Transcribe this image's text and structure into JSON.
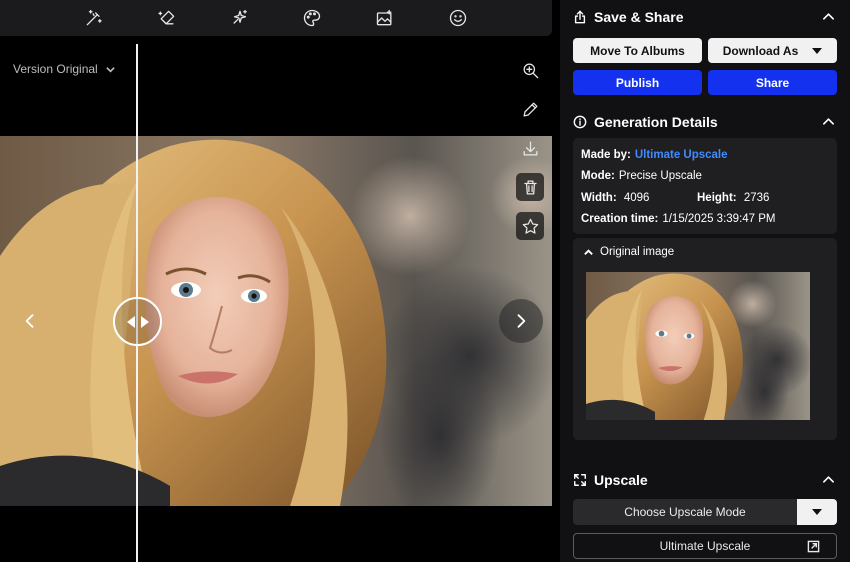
{
  "toolbar": {
    "tools": [
      "magic-wand-icon",
      "eraser-icon",
      "sparkles-icon",
      "palette-icon",
      "image-edit-icon",
      "smiley-icon"
    ]
  },
  "viewer": {
    "version_label": "Version Original",
    "side_tools": [
      "zoom-in-icon",
      "pencil-icon",
      "download-icon",
      "trash-icon",
      "star-icon"
    ]
  },
  "save_share": {
    "title": "Save & Share",
    "move_label": "Move To Albums",
    "download_label": "Download As",
    "publish_label": "Publish",
    "share_label": "Share"
  },
  "generation": {
    "title": "Generation Details",
    "made_by_label": "Made by:",
    "made_by_value": "Ultimate Upscale",
    "mode_label": "Mode:",
    "mode_value": "Precise Upscale",
    "width_label": "Width:",
    "width_value": "4096",
    "height_label": "Height:",
    "height_value": "2736",
    "created_label": "Creation time:",
    "created_value": "1/15/2025 3:39:47 PM",
    "original_label": "Original image"
  },
  "upscale": {
    "title": "Upscale",
    "mode_placeholder": "Choose Upscale Mode",
    "action_label": "Ultimate Upscale"
  },
  "colors": {
    "accent_blue": "#1431f0",
    "link_blue": "#3f8cff",
    "panel_bg": "#111113",
    "card_bg": "#1f1f22"
  }
}
